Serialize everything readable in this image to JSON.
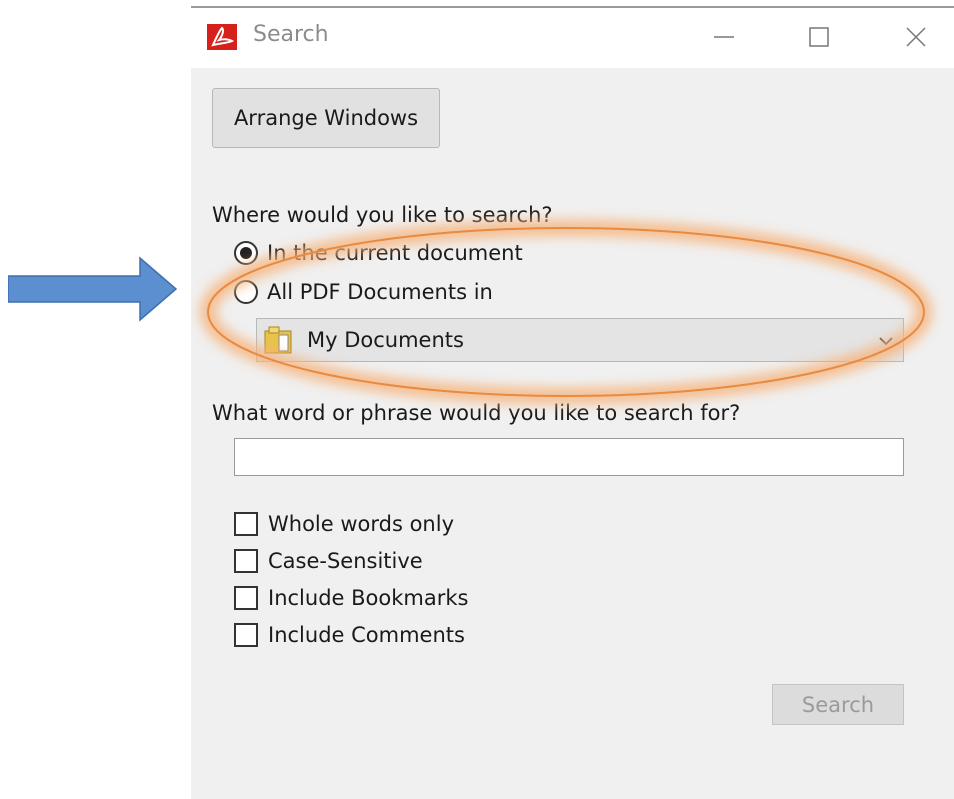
{
  "window": {
    "title": "Search",
    "app_icon": "acrobat-icon"
  },
  "titlebar_controls": {
    "minimize_icon": "minimize-icon",
    "maximize_icon": "maximize-icon",
    "close_icon": "close-icon"
  },
  "arrange_button": {
    "label": "Arrange Windows"
  },
  "where": {
    "heading": "Where would you like to search?",
    "options": [
      {
        "label": "In the current document",
        "selected": true
      },
      {
        "label": "All PDF Documents in",
        "selected": false
      }
    ],
    "folder_select": {
      "value": "My Documents",
      "icon": "folder-icon"
    }
  },
  "phrase": {
    "heading": "What word or phrase would you like to search for?",
    "value": ""
  },
  "options": {
    "checkboxes": [
      {
        "label": "Whole words only",
        "checked": false
      },
      {
        "label": "Case-Sensitive",
        "checked": false
      },
      {
        "label": "Include Bookmarks",
        "checked": false
      },
      {
        "label": "Include Comments",
        "checked": false
      }
    ]
  },
  "search_button": {
    "label": "Search",
    "enabled": false
  },
  "annotations": {
    "arrow_color": "#5b8fd0",
    "highlight_color": "#f0a060"
  },
  "colors": {
    "window_bg": "#f0f0f0",
    "acrobat_red": "#d6201c"
  }
}
